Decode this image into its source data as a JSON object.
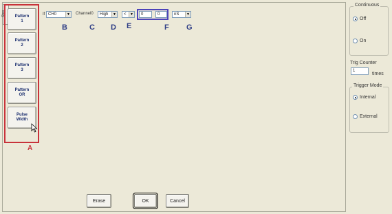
{
  "side_tab": "Step",
  "pattern_buttons": [
    {
      "label": "Pattern\n1"
    },
    {
      "label": "Pattern\n2"
    },
    {
      "label": "Pattern\n3"
    },
    {
      "label": "Pattern\nOR"
    },
    {
      "label": "Pulse\nWidth"
    }
  ],
  "callouts": {
    "a": "A",
    "b": "B",
    "c": "C",
    "d": "D",
    "e": "E",
    "f": "F",
    "g": "G"
  },
  "condition_row": {
    "if_label": "If",
    "channel_select": "CH0",
    "channel_label": "Channel0",
    "level_select": "High",
    "operator_select": "<",
    "value1": "0",
    "value2": "0",
    "unit_select": "nS"
  },
  "bottom_buttons": {
    "erase": "Erase",
    "ok": "OK",
    "cancel": "Cancel"
  },
  "continuous": {
    "title": "Continuous",
    "off": "Off",
    "on": "On",
    "selected": "Off"
  },
  "trig_counter": {
    "label": "Trig Counter",
    "value": "1",
    "unit": "times"
  },
  "trigger_mode": {
    "title": "Trigger Mode",
    "internal": "Internal",
    "external": "External",
    "selected": "Internal"
  }
}
